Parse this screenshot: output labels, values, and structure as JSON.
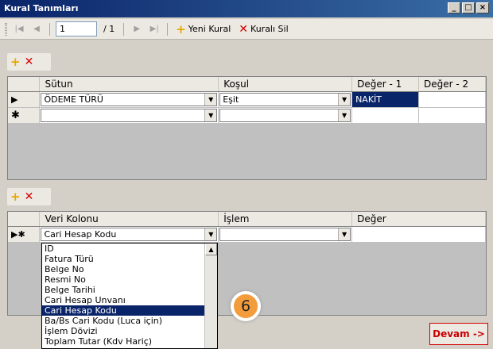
{
  "window": {
    "title": "Kural Tanımları",
    "btn_min": "_",
    "btn_max": "□",
    "btn_close": "×"
  },
  "toolbar": {
    "first": "|◀",
    "prev": "◀",
    "next": "▶",
    "last": "▶|",
    "page_value": "1",
    "page_total": "/ 1",
    "new_rule": "Yeni Kural",
    "delete_rule": "Kuralı Sil"
  },
  "rules_grid": {
    "columns": [
      "Sütun",
      "Koşul",
      "Değer - 1",
      "Değer - 2"
    ],
    "rows": [
      {
        "indicator": "▶",
        "sutun": "ÖDEME TÜRÜ",
        "kosul": "Eşit",
        "deger1": "NAKİT",
        "deger2": ""
      },
      {
        "indicator": "✱",
        "sutun": "",
        "kosul": "",
        "deger1": "",
        "deger2": ""
      }
    ]
  },
  "actions_grid": {
    "columns": [
      "Veri Kolonu",
      "İşlem",
      "Değer"
    ],
    "row": {
      "indicator": "▶✱",
      "veri_kolonu": "Cari Hesap Kodu",
      "islem": "",
      "deger": ""
    }
  },
  "dropdown": {
    "items": [
      "ID",
      "Fatura Türü",
      "Belge No",
      "Resmi No",
      "Belge Tarihi",
      "Cari Hesap Unvanı",
      "Cari Hesap Kodu",
      "Ba/Bs Cari Kodu (Luca için)",
      "İşlem Dövizi",
      "Toplam Tutar (Kdv Hariç)"
    ],
    "selected_index": 6
  },
  "badge": {
    "number": "6"
  },
  "devam": {
    "label": "Devam ->"
  }
}
